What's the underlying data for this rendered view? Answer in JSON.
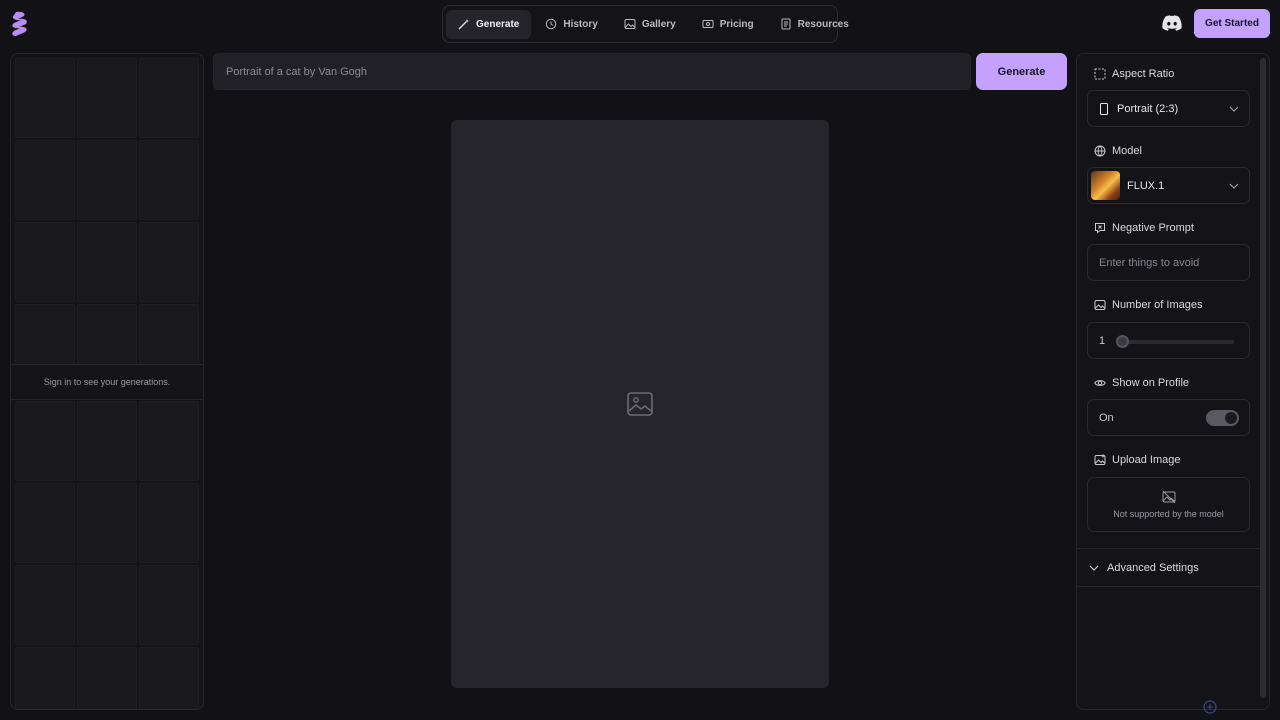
{
  "header": {
    "logo_icon": "brand-logo-icon",
    "nav": [
      {
        "label": "Generate",
        "icon": "magic-wand-icon",
        "active": true
      },
      {
        "label": "History",
        "icon": "history-icon",
        "active": false
      },
      {
        "label": "Gallery",
        "icon": "image-icon",
        "active": false
      },
      {
        "label": "Pricing",
        "icon": "ticket-icon",
        "active": false
      },
      {
        "label": "Resources",
        "icon": "document-icon",
        "active": false
      }
    ],
    "discord_icon": "discord-icon",
    "get_started_label": "Get Started"
  },
  "left_panel": {
    "signin_text": "Sign in to see your generations."
  },
  "main": {
    "prompt_placeholder": "Portrait of a cat by Van Gogh",
    "generate_label": "Generate",
    "canvas_icon": "image-placeholder-icon"
  },
  "settings": {
    "aspect_ratio": {
      "label": "Aspect Ratio",
      "value": "Portrait (2:3)"
    },
    "model": {
      "label": "Model",
      "value": "FLUX.1"
    },
    "negative_prompt": {
      "label": "Negative Prompt",
      "placeholder": "Enter things to avoid"
    },
    "num_images": {
      "label": "Number of Images",
      "value": "1"
    },
    "show_on_profile": {
      "label": "Show on Profile",
      "value": "On",
      "enabled": true
    },
    "upload_image": {
      "label": "Upload Image",
      "note": "Not supported by the model"
    },
    "advanced": {
      "label": "Advanced Settings"
    }
  },
  "colors": {
    "accent": "#c4a1ff",
    "background": "#121216",
    "panel": "#141418"
  }
}
